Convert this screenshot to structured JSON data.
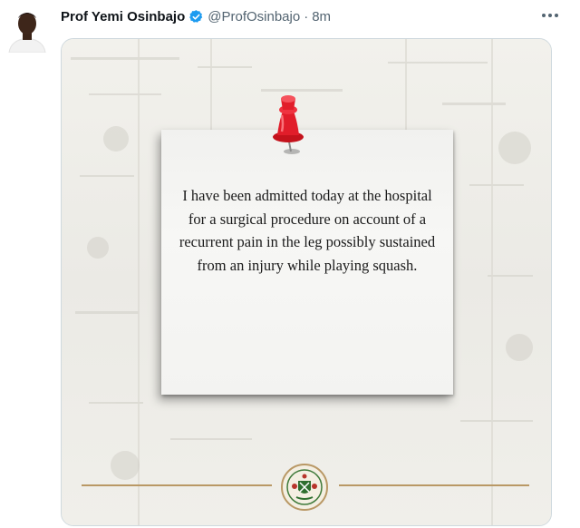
{
  "tweet": {
    "author_name": "Prof Yemi Osinbajo",
    "handle": "@ProfOsinbajo",
    "separator": "·",
    "timestamp": "8m"
  },
  "header": {
    "more_icon": "more-dots-icon",
    "verified_icon": "verified-badge-icon"
  },
  "media": {
    "note_text": "I have been admitted today at the hospital for a surgical procedure on account of a recurrent pain in the leg possibly sustained from an injury while playing squash.",
    "pin_color": "#e11d2a",
    "seal_icon": "coat-of-arms-seal-icon",
    "accent_line_color": "#b99865"
  },
  "colors": {
    "verified_blue": "#1d9bf0",
    "name_text": "#0f1419",
    "meta_text": "#536471",
    "border": "#cfd9de"
  }
}
